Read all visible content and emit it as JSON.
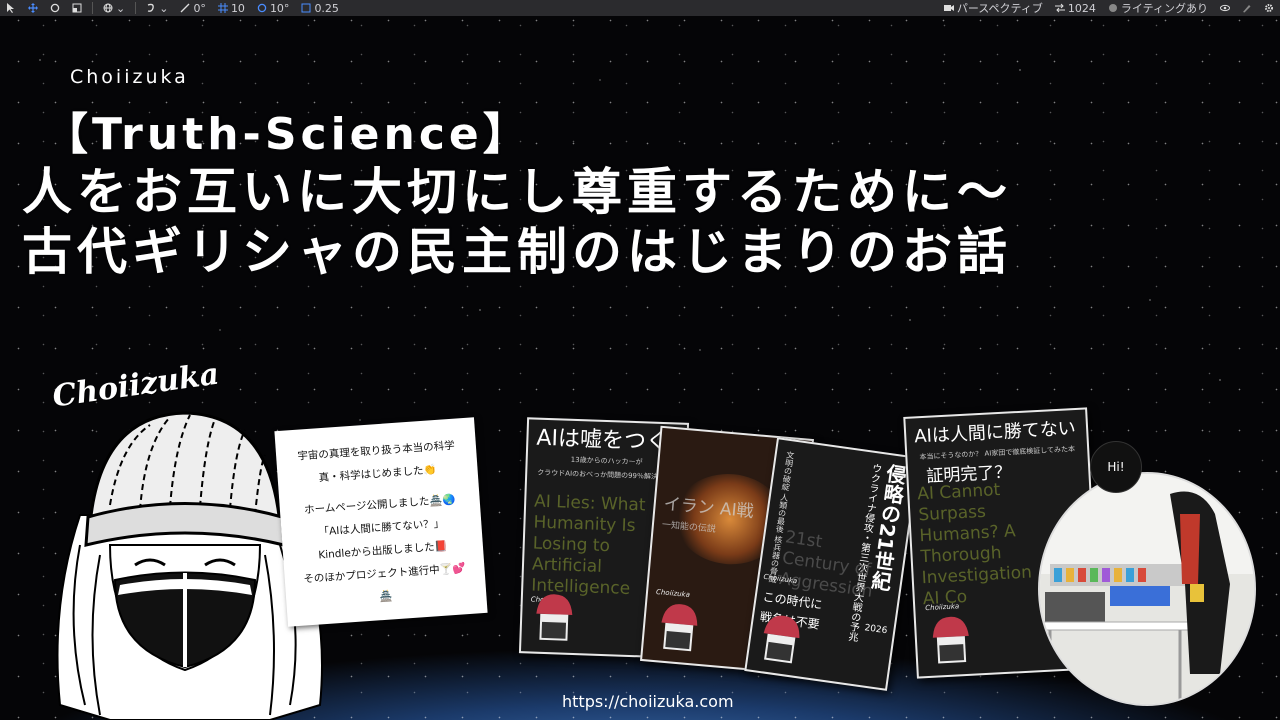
{
  "toolbar": {
    "items": [
      {
        "icon": "pointer-icon",
        "value": ""
      },
      {
        "icon": "move-icon",
        "value": ""
      },
      {
        "icon": "rotate-icon",
        "value": ""
      },
      {
        "icon": "scale-icon",
        "value": ""
      },
      {
        "icon": "globe-icon",
        "value": ""
      },
      {
        "icon": "snap-icon",
        "value": ""
      },
      {
        "icon": "angle-snap-icon",
        "value": "0°"
      },
      {
        "icon": "grid-icon",
        "value": "10"
      },
      {
        "icon": "rotation-snap-icon",
        "value": "10°"
      },
      {
        "icon": "scale-snap-icon",
        "value": "0.25"
      },
      {
        "icon": "camera-icon",
        "value": "パースペクティブ"
      },
      {
        "icon": "resolution-icon",
        "value": "1024"
      },
      {
        "icon": "lighting-icon",
        "value": "ライティングあり"
      },
      {
        "icon": "eye-icon",
        "value": ""
      },
      {
        "icon": "brush-icon",
        "value": ""
      },
      {
        "icon": "settings-icon",
        "value": ""
      }
    ]
  },
  "site_name": "Choiizuka",
  "title": {
    "line1": "【Truth-Science】",
    "line2": "人をお互いに大切にし尊重するために～",
    "line3": "古代ギリシャの民主制のはじまりのお話"
  },
  "signature": "Choiizuka",
  "note_card": {
    "lines": [
      "宇宙の真理を取り扱う本当の科学",
      "真・科学はじめました👏",
      "",
      "ホームページ公開しました🏯🌏",
      "「AIは人間に勝てない？」",
      "Kindleから出版しました📕",
      "そのほかプロジェクト進行中🍸💕",
      "🏯"
    ]
  },
  "books": [
    {
      "title": "AIは嘘をつく",
      "subtitle": "13歳からのハッカーが",
      "subtitle2": "クラウドAIのおべっか問題の99％解決法を発",
      "bg_text": [
        "AI Lies: What",
        "Humanity Is",
        "Losing to",
        "Artificial",
        "Intelligence"
      ],
      "brand": "Choiizuka"
    },
    {
      "title": "イラン",
      "subtitle": "ナウカ 知能の伝説",
      "bg_text": [
        "イラン AI戦",
        "一知能の伝説"
      ],
      "brand": "Choiizuka"
    },
    {
      "title": "侵略の21世紀",
      "subtitle": "ウクライナ侵攻・第三次世界大戦の予兆",
      "year": "2026",
      "side_text": [
        "文明の破綻",
        "人類の最後",
        "核兵器の脅威"
      ],
      "bg_text": [
        "21st",
        "Century of",
        "Aggression"
      ],
      "bottom": [
        "この時代に",
        "戦争は不要"
      ],
      "brand": "Choiizuka"
    },
    {
      "title": "AIは人間に勝てない",
      "title2": "証明完了？",
      "subtitle": "本当にそうなのか？ AI家団で徹底検証してみた本",
      "bg_text": [
        "AI Cannot",
        "Surpass",
        "Humans? A",
        "Thorough",
        "Investigation",
        "AI Co"
      ],
      "brand": "Choiizuka"
    }
  ],
  "photo": {
    "bubble": "Hi!"
  },
  "url": "https://choiizuka.com",
  "colors": {
    "toolbar_bg": "#2b2b2e",
    "note_bg": "#ffffff",
    "beanie": "#c0394a",
    "earth_glow": "#3d6fb0"
  }
}
